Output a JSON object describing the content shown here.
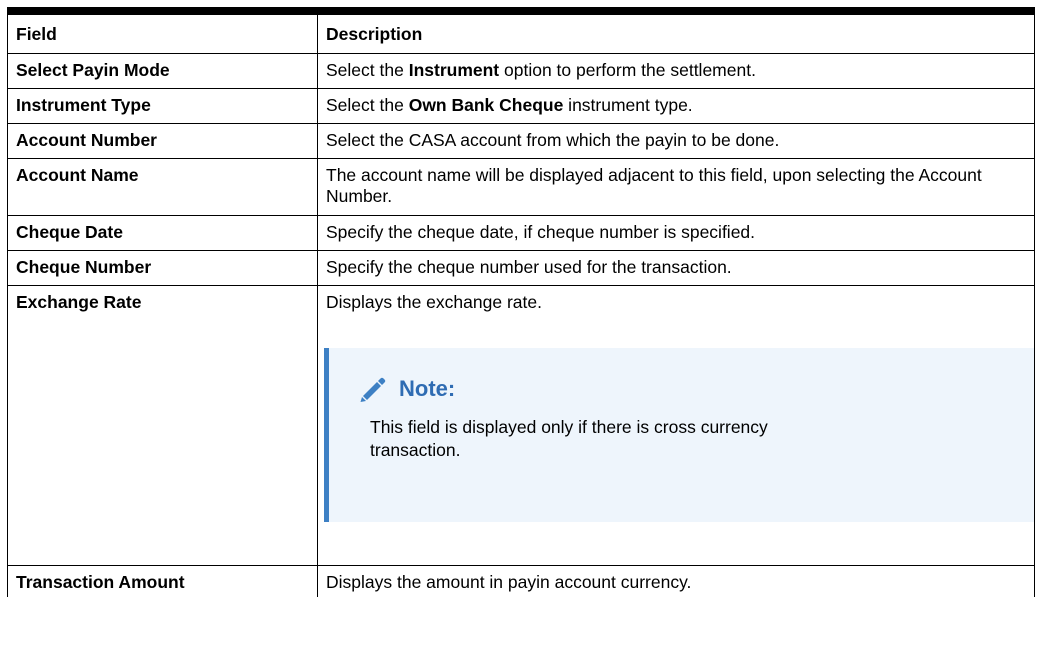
{
  "table": {
    "header": {
      "field": "Field",
      "description": "Description"
    },
    "rows": [
      {
        "field": "Select Payin Mode",
        "desc_before": "Select the ",
        "desc_bold": "Instrument",
        "desc_after": " option to perform the settlement."
      },
      {
        "field": "Instrument Type",
        "desc_before": "Select the ",
        "desc_bold": "Own Bank Cheque",
        "desc_after": " instrument type."
      },
      {
        "field": "Account Number",
        "description": "Select the CASA account from which the payin to be done."
      },
      {
        "field": "Account Name",
        "description": "The account name will be displayed adjacent to this field, upon selecting the Account Number."
      },
      {
        "field": "Cheque Date",
        "description": "Specify the cheque date, if cheque number is specified."
      },
      {
        "field": "Cheque Number",
        "description": "Specify the cheque number used for the transaction."
      },
      {
        "field": "Exchange Rate",
        "description": "Displays the exchange rate.",
        "note": {
          "icon": "pencil-icon",
          "title": "Note:",
          "text": "This field is displayed only if there is cross currency transaction."
        }
      },
      {
        "field": "Transaction Amount",
        "description": "Displays the amount in payin account currency."
      }
    ]
  },
  "colors": {
    "border": "#000000",
    "note_background": "#eef5fc",
    "note_accent": "#3d80c4",
    "note_title": "#2f6cb3"
  }
}
